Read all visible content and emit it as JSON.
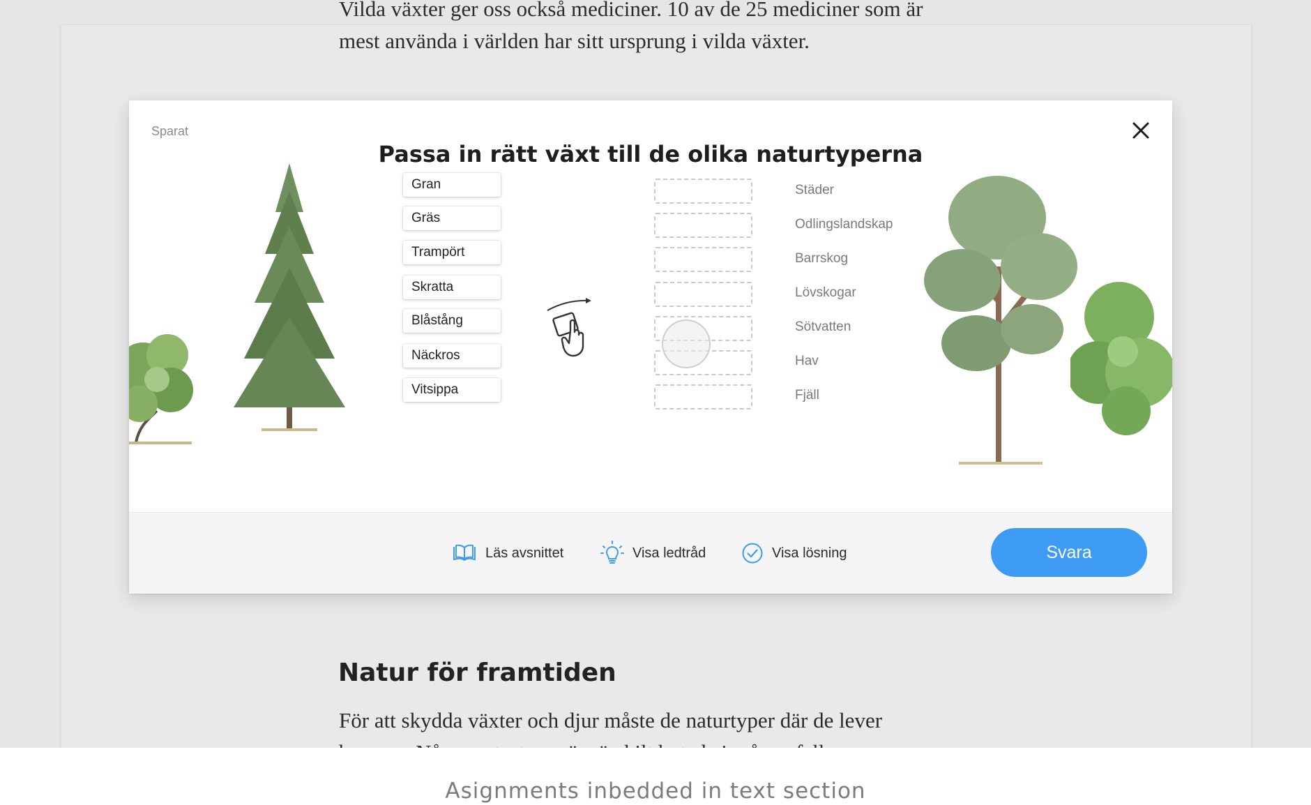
{
  "article": {
    "intro_line_1": "Vilda växter ger oss också mediciner. 10 av de 25 mediciner som är",
    "intro_line_2": "mest använda i världen har sitt ursprung i vilda växter.",
    "section_heading": "Natur för framtiden",
    "section_line_1": "För att skydda växter och djur måste de naturtyper där de lever",
    "section_line_2": "bevaras. Några naturtyper är särskilt hotade i många fall"
  },
  "assignment": {
    "status": "Sparat",
    "title": "Passa in rätt växt till de olika naturtyperna",
    "plants": [
      "Gran",
      "Gräs",
      "Trampört",
      "Skratta",
      "Blåstång",
      "Näckros",
      "Vitsippa"
    ],
    "habitats": [
      "Städer",
      "Odlingslandskap",
      "Barrskog",
      "Lövskogar",
      "Sötvatten",
      "Hav",
      "Fjäll"
    ],
    "actions": {
      "read_section": "Läs avsnittet",
      "show_hint": "Visa ledtråd",
      "show_solution": "Visa lösning",
      "answer": "Svara"
    },
    "accent_color": "#3d9bf3"
  },
  "caption": "Asignments inbedded in text section",
  "icons": [
    "close-icon",
    "book-icon",
    "lightbulb-icon",
    "check-circle-icon",
    "drag-hand-icon"
  ]
}
